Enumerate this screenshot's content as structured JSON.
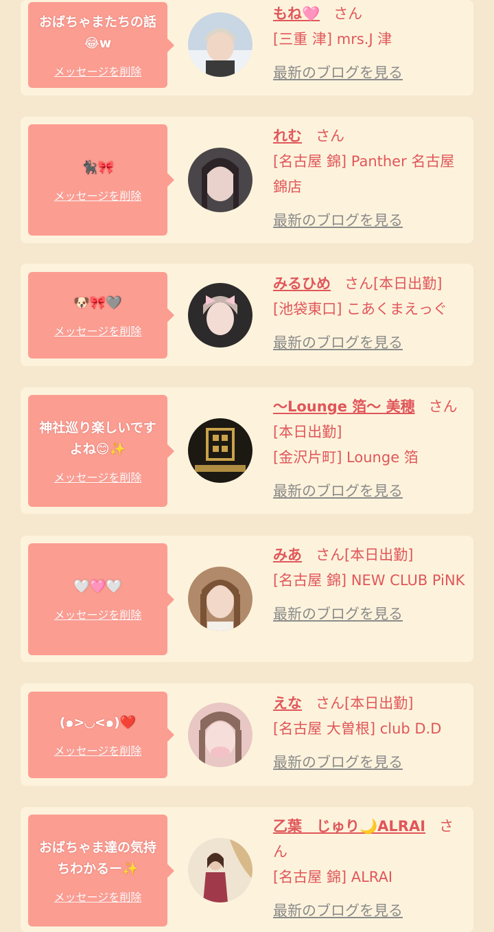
{
  "colors": {
    "page_bg": "#f5e8cf",
    "card_bg": "#fdf3dc",
    "bubble_bg": "#fc9d92",
    "accent": "#e0565a",
    "link_gray": "#8a8a8a"
  },
  "delete_label": "メッセージを削除",
  "blog_label": "最新のブログを見る",
  "entries": [
    {
      "message": "おばちゃまたちの話😂w",
      "name": "もね🩷",
      "san": "さん",
      "shop": "[三重 津] mrs.J 津"
    },
    {
      "message": "🐈‍⬛🎀",
      "name": "れむ",
      "san": "さん",
      "shop": "[名古屋 錦] Panther 名古屋錦店"
    },
    {
      "message": "🐶🎀🩶",
      "name": "みるひめ",
      "san": "さん[本日出勤]",
      "shop": "[池袋東口] こあくまえっぐ"
    },
    {
      "message": "神社巡り楽しいですよね😊✨",
      "name": "〜Lounge 箔〜 美穂",
      "san": "さん[本日出勤]",
      "shop": "[金沢片町] Lounge 箔"
    },
    {
      "message": "🤍🩷🤍",
      "name": "みあ",
      "san": "さん[本日出勤]",
      "shop": "[名古屋 錦] NEW CLUB PiNK"
    },
    {
      "message": "(๑>◡<๑)❤️",
      "name": "えな",
      "san": "さん[本日出勤]",
      "shop": "[名古屋 大曽根] club D.D"
    },
    {
      "message": "おばちゃま達の気持ちわかるー✨",
      "name": "乙葉　じゅり🌙ALRAI",
      "san": "さん",
      "shop": "[名古屋 錦] ALRAI"
    }
  ]
}
